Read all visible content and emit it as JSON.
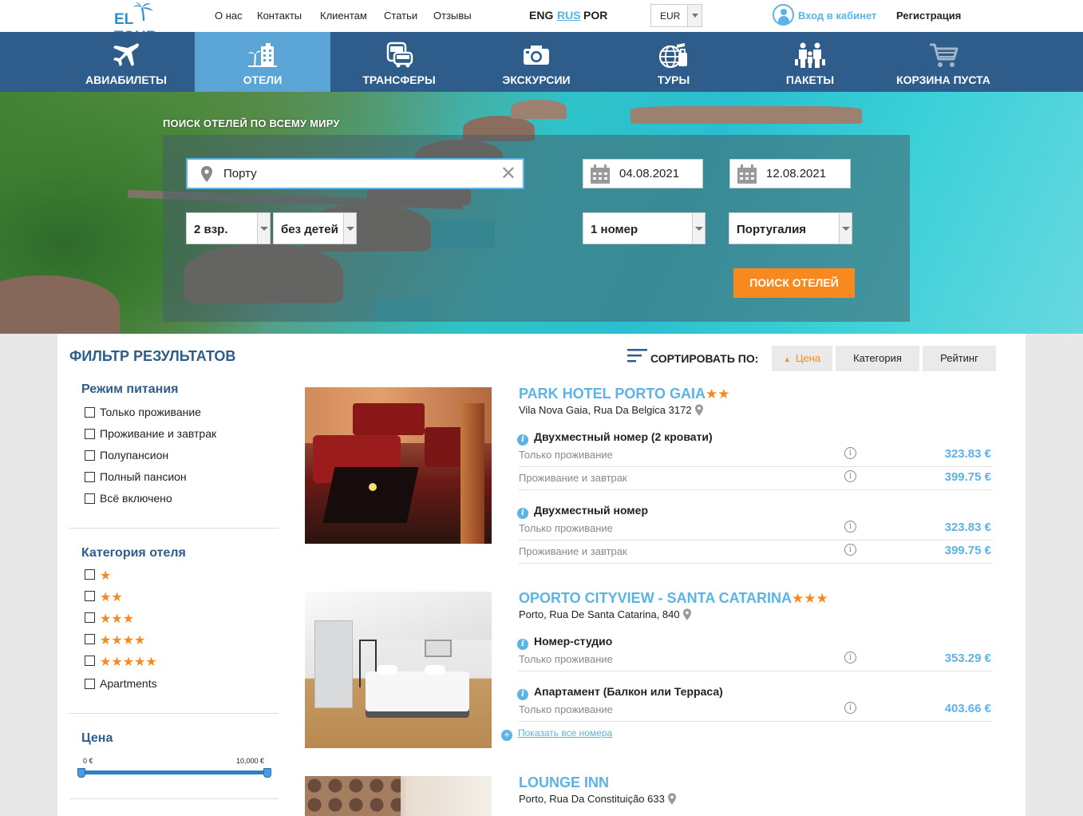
{
  "header": {
    "logo_text": "EL TOUR",
    "nav": [
      "О нас",
      "Контакты",
      "Клиентам",
      "Статьи",
      "Отзывы"
    ],
    "languages": [
      {
        "code": "ENG",
        "active": false
      },
      {
        "code": "RUS",
        "active": true
      },
      {
        "code": "POR",
        "active": false
      }
    ],
    "currency": "EUR",
    "login_label": "Вход в кабинет",
    "register_label": "Регистрация"
  },
  "main_nav": [
    {
      "label": "Авиабилеты",
      "icon": "airplane-icon",
      "active": false
    },
    {
      "label": "Отели",
      "icon": "hotel-icon",
      "active": true
    },
    {
      "label": "Трансферы",
      "icon": "transfer-bus-icon",
      "active": false
    },
    {
      "label": "Экскурсии",
      "icon": "camera-icon",
      "active": false
    },
    {
      "label": "Туры",
      "icon": "globe-luggage-icon",
      "active": false
    },
    {
      "label": "Пакеты",
      "icon": "family-icon",
      "active": false
    },
    {
      "label": "Корзина пуста",
      "icon": "cart-icon",
      "active": false
    }
  ],
  "search": {
    "heading": "Поиск отелей по всему миру",
    "destination": "Порту",
    "checkin": "04.08.2021",
    "checkout": "12.08.2021",
    "adults": "2 взр.",
    "children": "без детей",
    "rooms": "1 номер",
    "country": "Португалия",
    "button": "Поиск отелей"
  },
  "filters": {
    "title": "Фильтр результатов",
    "meal": {
      "title": "Режим питания",
      "options": [
        "Только проживание",
        "Проживание и завтрак",
        "Полупансион",
        "Полный пансион",
        "Всё включено"
      ]
    },
    "category": {
      "title": "Категория отеля",
      "star_options": [
        1,
        2,
        3,
        4,
        5
      ],
      "apartments_label": "Apartments"
    },
    "price": {
      "title": "Цена",
      "min_label": "0 €",
      "max_label": "10,000 €",
      "range_fraction": [
        0,
        1
      ]
    }
  },
  "sort": {
    "label": "Сортировать по:",
    "options": [
      {
        "label": "Цена",
        "active": true
      },
      {
        "label": "Категория",
        "active": false
      },
      {
        "label": "Рейтинг",
        "active": false
      }
    ]
  },
  "hotels": [
    {
      "name": "Park Hotel Porto Gaia",
      "stars": 2,
      "address": "Vila Nova Gaia, Rua Da Belgica 3172",
      "rooms": [
        {
          "name": "Двухместный номер (2 кровати)",
          "rates": [
            {
              "meal": "Только проживание",
              "price": "323.83 €"
            },
            {
              "meal": "Проживание и завтрак",
              "price": "399.75 €"
            }
          ]
        },
        {
          "name": "Двухместный номер",
          "rates": [
            {
              "meal": "Только проживание",
              "price": "323.83 €"
            },
            {
              "meal": "Проживание и завтрак",
              "price": "399.75 €"
            }
          ]
        }
      ]
    },
    {
      "name": "Oporto Cityview - Santa Catarina",
      "stars": 3,
      "address": "Porto, Rua De Santa Catarina, 840",
      "rooms": [
        {
          "name": "Номер-студио",
          "rates": [
            {
              "meal": "Только проживание",
              "price": "353.29 €"
            }
          ]
        },
        {
          "name": "Апартамент (Балкон или Терраса)",
          "rates": [
            {
              "meal": "Только проживание",
              "price": "403.66 €"
            }
          ]
        }
      ],
      "show_all_label": "Показать все номера"
    },
    {
      "name": "Lounge Inn",
      "stars": 0,
      "address": "Porto, Rua Da Constituição 633"
    }
  ],
  "colors": {
    "brand_blue": "#2e5d8c",
    "accent_blue": "#5bb3e6",
    "orange": "#f7891f",
    "active_tab": "#5aa5d6"
  }
}
